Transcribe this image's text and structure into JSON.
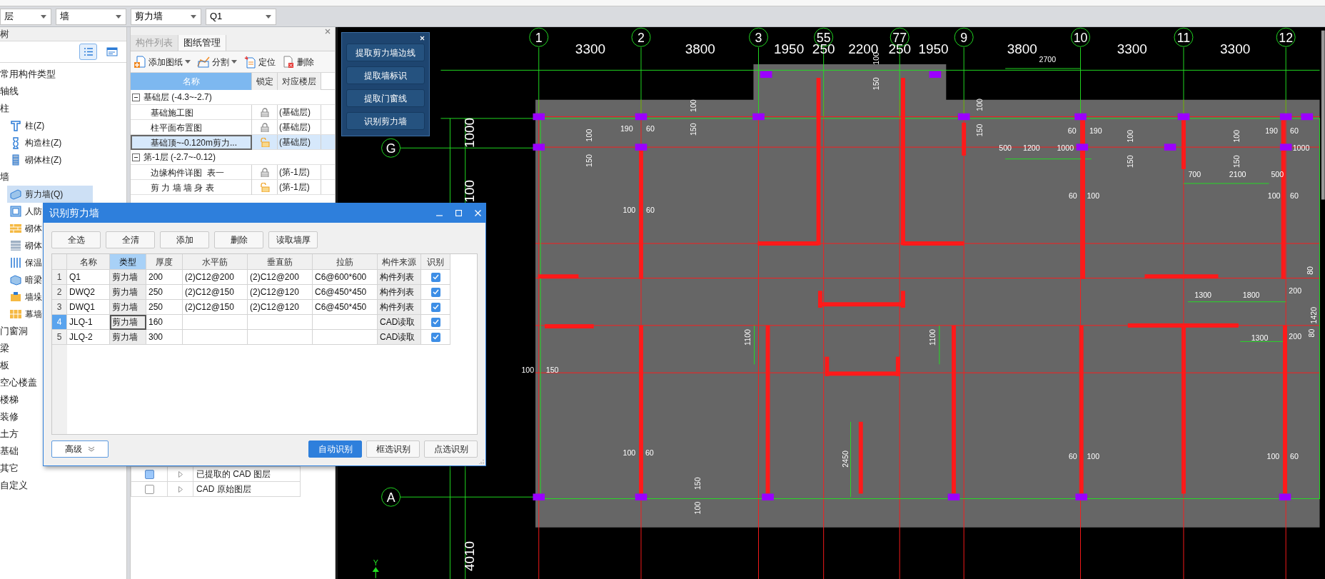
{
  "top_bar": {
    "dropdowns": [
      {
        "value": "层"
      },
      {
        "value": "墙"
      },
      {
        "value": "剪力墙"
      },
      {
        "value": "Q1"
      }
    ]
  },
  "component_tree": {
    "title": "树",
    "view_buttons": [
      {
        "kind": "list",
        "selected": true
      },
      {
        "kind": "detail",
        "selected": false
      }
    ],
    "items": [
      {
        "label": "常用构件类型"
      },
      {
        "label": "轴线"
      },
      {
        "label": "柱",
        "children": [
          {
            "label": "柱(Z)",
            "kind": "column",
            "selected": false
          },
          {
            "label": "构造柱(Z)",
            "kind": "tiecolumn",
            "selected": false
          },
          {
            "label": "砌体柱(Z)",
            "kind": "masoncolumn",
            "selected": false
          }
        ]
      },
      {
        "label": "墙",
        "children": [
          {
            "label": "剪力墙(Q)",
            "kind": "shearwall",
            "selected": true
          },
          {
            "label": "人防",
            "kind": "framewall",
            "selected": false
          },
          {
            "label": "砌体",
            "kind": "brick",
            "selected": false
          },
          {
            "label": "砌体",
            "kind": "brickgray",
            "selected": false
          },
          {
            "label": "保温",
            "kind": "insulation",
            "selected": false
          },
          {
            "label": "暗梁",
            "kind": "beam",
            "selected": false
          },
          {
            "label": "墙垛",
            "kind": "pier",
            "selected": false
          },
          {
            "label": "幕墙",
            "kind": "curtain",
            "selected": false
          }
        ]
      },
      {
        "label": "门窗洞"
      },
      {
        "label": "梁"
      },
      {
        "label": "板"
      },
      {
        "label": "空心楼盖"
      },
      {
        "label": "楼梯"
      },
      {
        "label": "装修"
      },
      {
        "label": "土方"
      },
      {
        "label": "基础"
      },
      {
        "label": "其它"
      },
      {
        "label": "自定义"
      }
    ]
  },
  "drawing_panel": {
    "tabs": [
      {
        "label": "构件列表",
        "selected": false
      },
      {
        "label": "图纸管理",
        "selected": true
      }
    ],
    "toolbar": [
      {
        "label": "添加图纸",
        "kind": "add",
        "menu": true
      },
      {
        "label": "分割",
        "kind": "split",
        "menu": true
      },
      {
        "label": "定位",
        "kind": "locate",
        "menu": false
      },
      {
        "label": "删除",
        "kind": "delete",
        "menu": false
      }
    ],
    "columns": [
      {
        "label": "名称",
        "selected": true
      },
      {
        "label": "锁定",
        "selected": false
      },
      {
        "label": "对应楼层",
        "selected": false
      }
    ],
    "groups": [
      {
        "label": "基础层 (-4.3~-2.7)",
        "expanded": true,
        "drawings": [
          {
            "name": "基础施工图",
            "locked": true,
            "floor": "(基础层)",
            "selected": false
          },
          {
            "name": "柱平面布置图",
            "locked": true,
            "floor": "(基础层)",
            "selected": false
          },
          {
            "name": "基础顶~-0.120m剪力...",
            "locked": false,
            "floor": "(基础层)",
            "selected": true
          }
        ]
      },
      {
        "label": "第-1层 (-2.7~-0.12)",
        "expanded": true,
        "drawings": [
          {
            "name": "边缘构件详图  表一",
            "locked": true,
            "floor": "(第-1层)",
            "selected": false
          },
          {
            "name": "剪 力 墙 墙 身 表",
            "locked": false,
            "floor": "(第-1层)",
            "selected": false
          }
        ]
      }
    ],
    "layers": [
      {
        "label": "已提取的 CAD 图层",
        "checked": true
      },
      {
        "label": "CAD 原始图层",
        "checked": false
      }
    ]
  },
  "cad_toolbar": {
    "buttons": [
      "提取剪力墙边线",
      "提取墙标识",
      "提取门窗线",
      "识别剪力墙"
    ]
  },
  "cad_view": {
    "column_axes": [
      "1",
      "2",
      "3",
      "55",
      "77",
      "9",
      "10",
      "11",
      "12"
    ],
    "row_axes": [
      "G",
      "A"
    ],
    "top_dimensions": [
      "3300",
      "3800",
      "1950",
      "250",
      "2200",
      "250",
      "1950",
      "3800",
      "3300",
      "3300"
    ],
    "left_dimensions": [
      "1000",
      "100",
      "4010"
    ],
    "annotations": [
      "2700",
      "100",
      "150",
      "100",
      "100",
      "190",
      "60",
      "150",
      "150",
      "60",
      "190",
      "190",
      "60",
      "100",
      "100",
      "100",
      "500",
      "1200",
      "1000",
      "1000",
      "150",
      "150",
      "150",
      "700",
      "2100",
      "500",
      "60",
      "100",
      "100",
      "60",
      "100",
      "60",
      "80",
      "200",
      "1300",
      "1800",
      "1420",
      "80",
      "200",
      "1100",
      "1100",
      "1300",
      "100",
      "150",
      "100",
      "60",
      "60",
      "100",
      "100",
      "60",
      "2450",
      "150",
      "100"
    ],
    "ucs_label": "Y"
  },
  "dialog": {
    "title": "识别剪力墙",
    "buttons": [
      "全选",
      "全清",
      "添加",
      "删除",
      "读取墙厚"
    ],
    "columns": [
      {
        "label": "名称",
        "selected": false
      },
      {
        "label": "类型",
        "selected": true
      },
      {
        "label": "厚度",
        "selected": false
      },
      {
        "label": "水平筋",
        "selected": false
      },
      {
        "label": "垂直筋",
        "selected": false
      },
      {
        "label": "拉筋",
        "selected": false
      },
      {
        "label": "构件来源",
        "selected": false
      },
      {
        "label": "识别",
        "selected": false
      }
    ],
    "rows": [
      {
        "index": "1",
        "name": "Q1",
        "type": "剪力墙",
        "thickness": "200",
        "horizontal": "(2)C12@200",
        "vertical": "(2)C12@200",
        "tie": "C6@600*600",
        "source": "构件列表",
        "recognize": true,
        "selected": false
      },
      {
        "index": "2",
        "name": "DWQ2",
        "type": "剪力墙",
        "thickness": "250",
        "horizontal": "(2)C12@150",
        "vertical": "(2)C12@120",
        "tie": "C6@450*450",
        "source": "构件列表",
        "recognize": true,
        "selected": false
      },
      {
        "index": "3",
        "name": "DWQ1",
        "type": "剪力墙",
        "thickness": "250",
        "horizontal": "(2)C12@150",
        "vertical": "(2)C12@120",
        "tie": "C6@450*450",
        "source": "构件列表",
        "recognize": true,
        "selected": false
      },
      {
        "index": "4",
        "name": "JLQ-1",
        "type": "剪力墙",
        "thickness": "160",
        "source": "CAD读取",
        "recognize": true,
        "selected": true
      },
      {
        "index": "5",
        "name": "JLQ-2",
        "type": "剪力墙",
        "thickness": "300",
        "source": "CAD读取",
        "recognize": true,
        "selected": false
      }
    ],
    "advanced": "高级",
    "actions": [
      {
        "label": "自动识别",
        "primary": true
      },
      {
        "label": "框选识别",
        "primary": false
      },
      {
        "label": "点选识别",
        "primary": false
      }
    ]
  }
}
